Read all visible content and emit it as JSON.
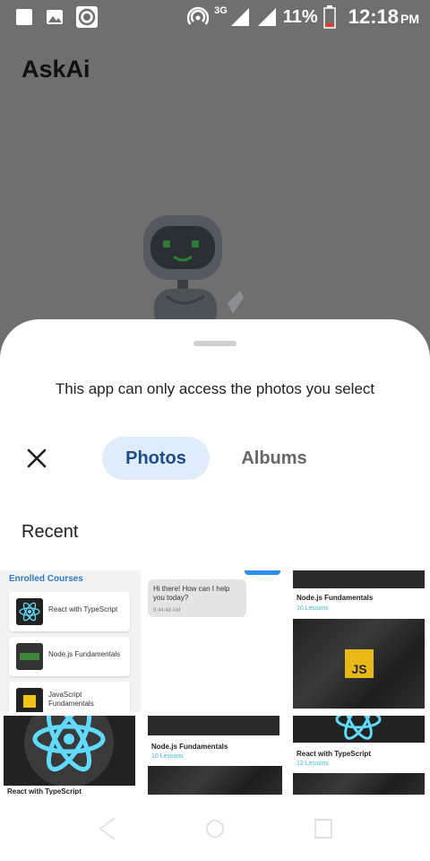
{
  "status_bar": {
    "network_label": "3G",
    "battery_percent": "11%",
    "time": "12:18",
    "ampm": "PM",
    "colors": {
      "battery_low": "#e53935"
    }
  },
  "app": {
    "title": "AskAi"
  },
  "picker": {
    "message": "This app can only access the photos you select",
    "tabs": [
      {
        "label": "Photos",
        "selected": true
      },
      {
        "label": "Albums",
        "selected": false
      }
    ],
    "section_label": "Recent",
    "accent_color": "#1c4c8a",
    "selected_tab_bg": "#e1ecfb"
  },
  "photos": {
    "a": {
      "title": "Enrolled Courses",
      "courses": [
        "React with TypeScript",
        "Node.js Fundamentals",
        "JavaScript Fundamentals"
      ]
    },
    "b": {
      "chat_text": "Hi there! How can I help you today?",
      "chat_time": "9:44:48 AM"
    },
    "c": {
      "title": "Node.js Fundamentals",
      "subtitle": "10 Lessons",
      "badge": "JS"
    },
    "d": {
      "title": "React with TypeScript"
    },
    "e": {
      "title": "Node.js Fundamentals",
      "subtitle": "10 Lessons"
    },
    "f": {
      "title": "React with TypeScript",
      "subtitle": "12 Lessons"
    }
  },
  "icons": {
    "status_left": [
      "square-notification-icon",
      "image-icon",
      "record-icon"
    ],
    "status_right": [
      "hotspot-icon",
      "signal-icon",
      "wifi-icon",
      "battery-icon"
    ],
    "nav": [
      "back-icon",
      "home-icon",
      "recents-icon"
    ]
  }
}
